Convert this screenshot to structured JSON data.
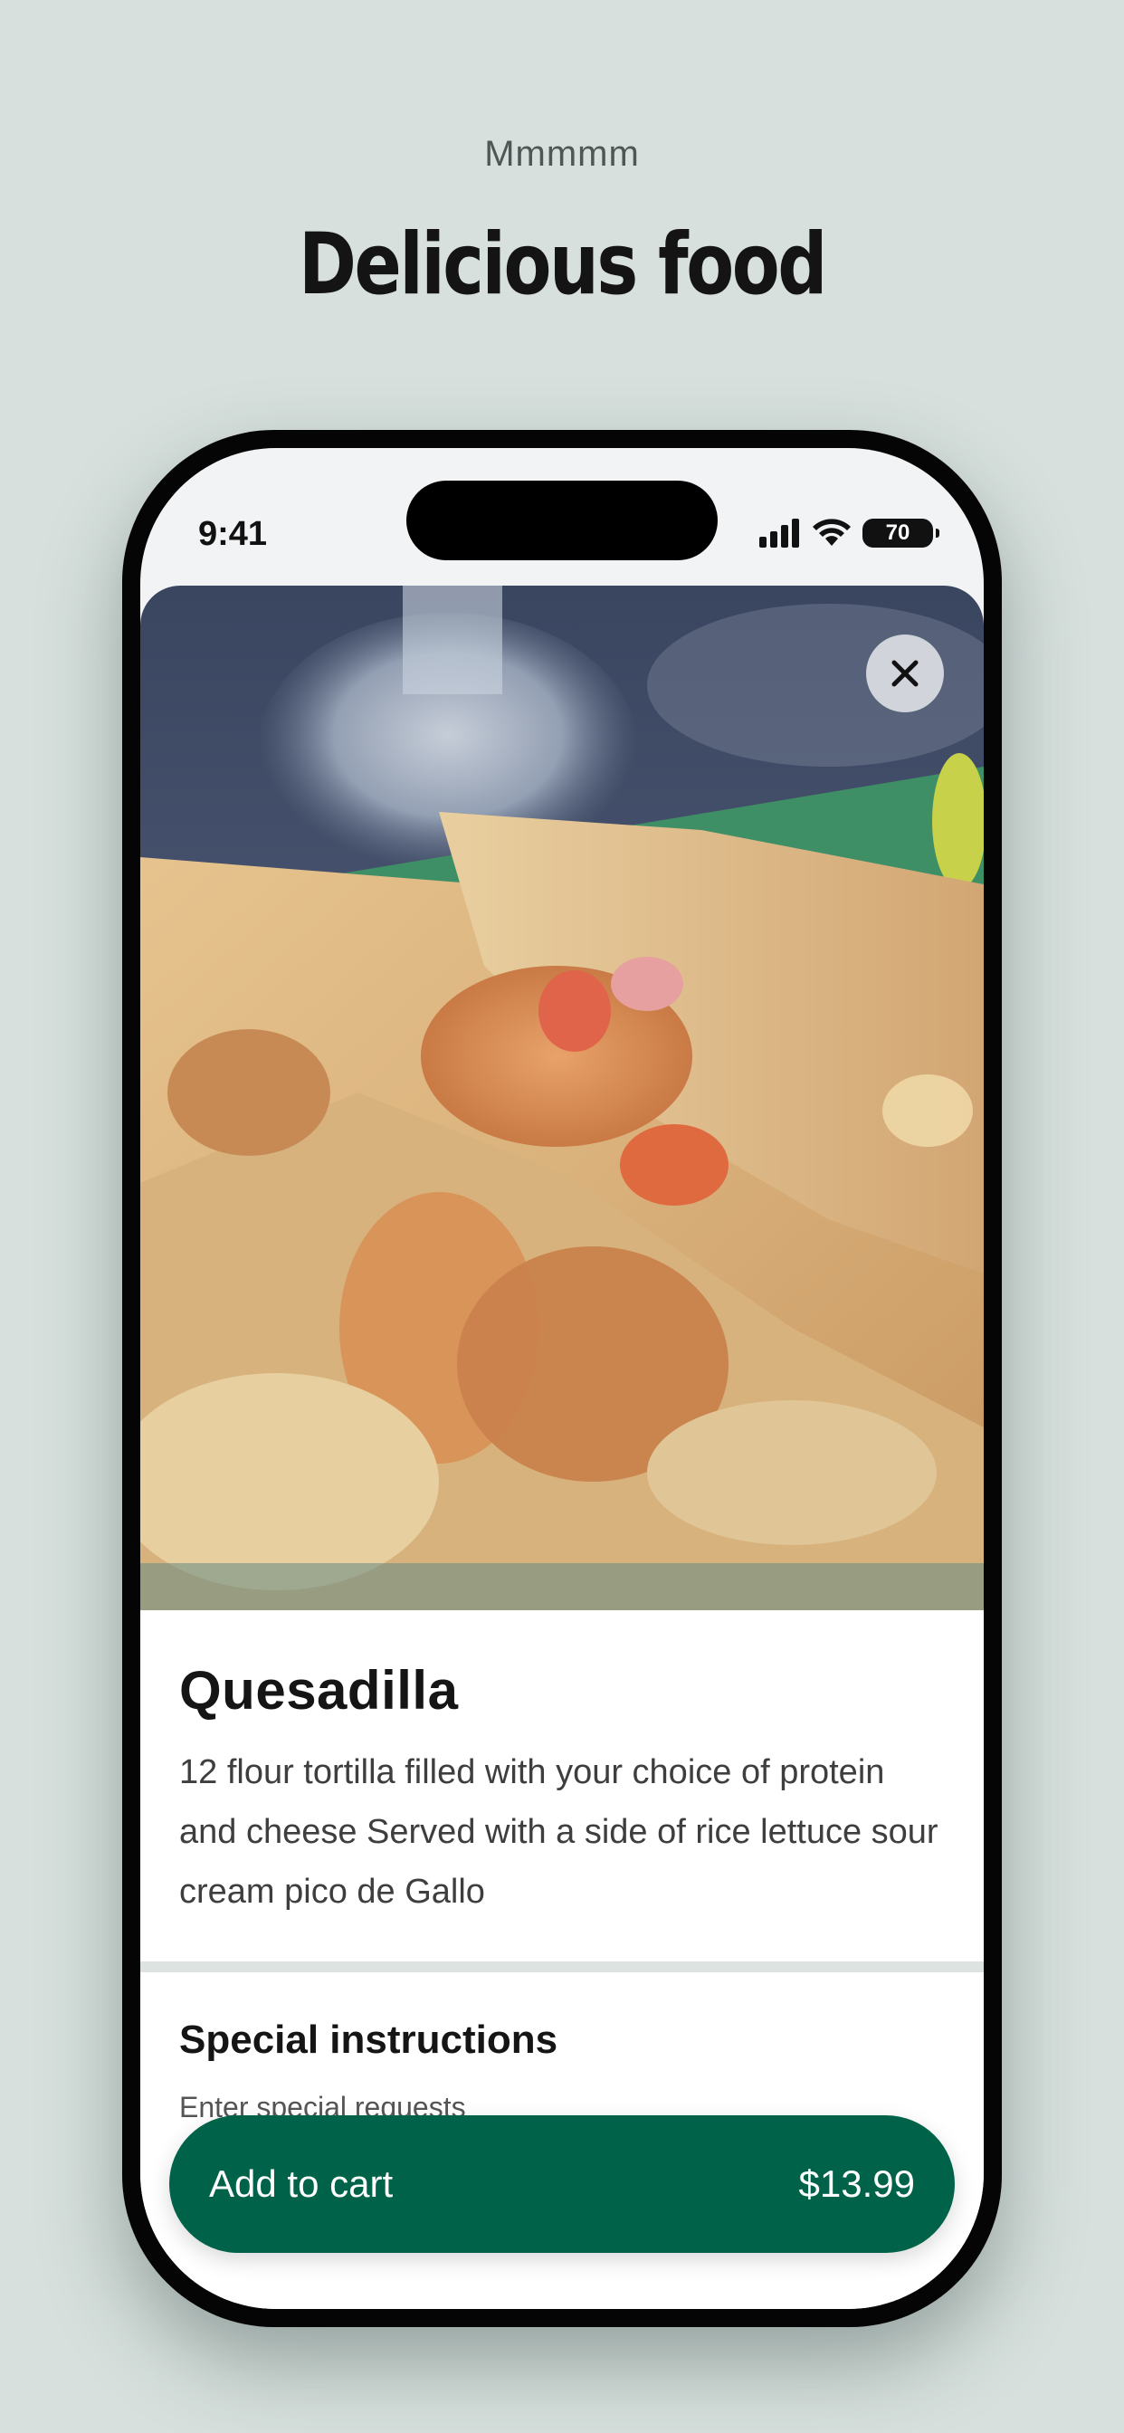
{
  "page": {
    "eyebrow": "Mmmmm",
    "headline": "Delicious food"
  },
  "status_bar": {
    "time": "9:41",
    "battery": "70",
    "icons": [
      "signal-icon",
      "wifi-icon",
      "battery-icon"
    ]
  },
  "item": {
    "image_icon": "quesadilla-photo",
    "close_icon": "close-icon",
    "title": "Quesadilla",
    "description": "12 flour tortilla filled with your choice of protein and cheese Served with a side of rice lettuce sour cream pico de Gallo"
  },
  "special_instructions": {
    "title": "Special instructions",
    "placeholder": "Enter special requests",
    "value": ""
  },
  "cart_button": {
    "label": "Add to cart",
    "price": "$13.99",
    "color": "#006349"
  },
  "colors": {
    "background": "#d7e0dd",
    "accent": "#006349"
  }
}
